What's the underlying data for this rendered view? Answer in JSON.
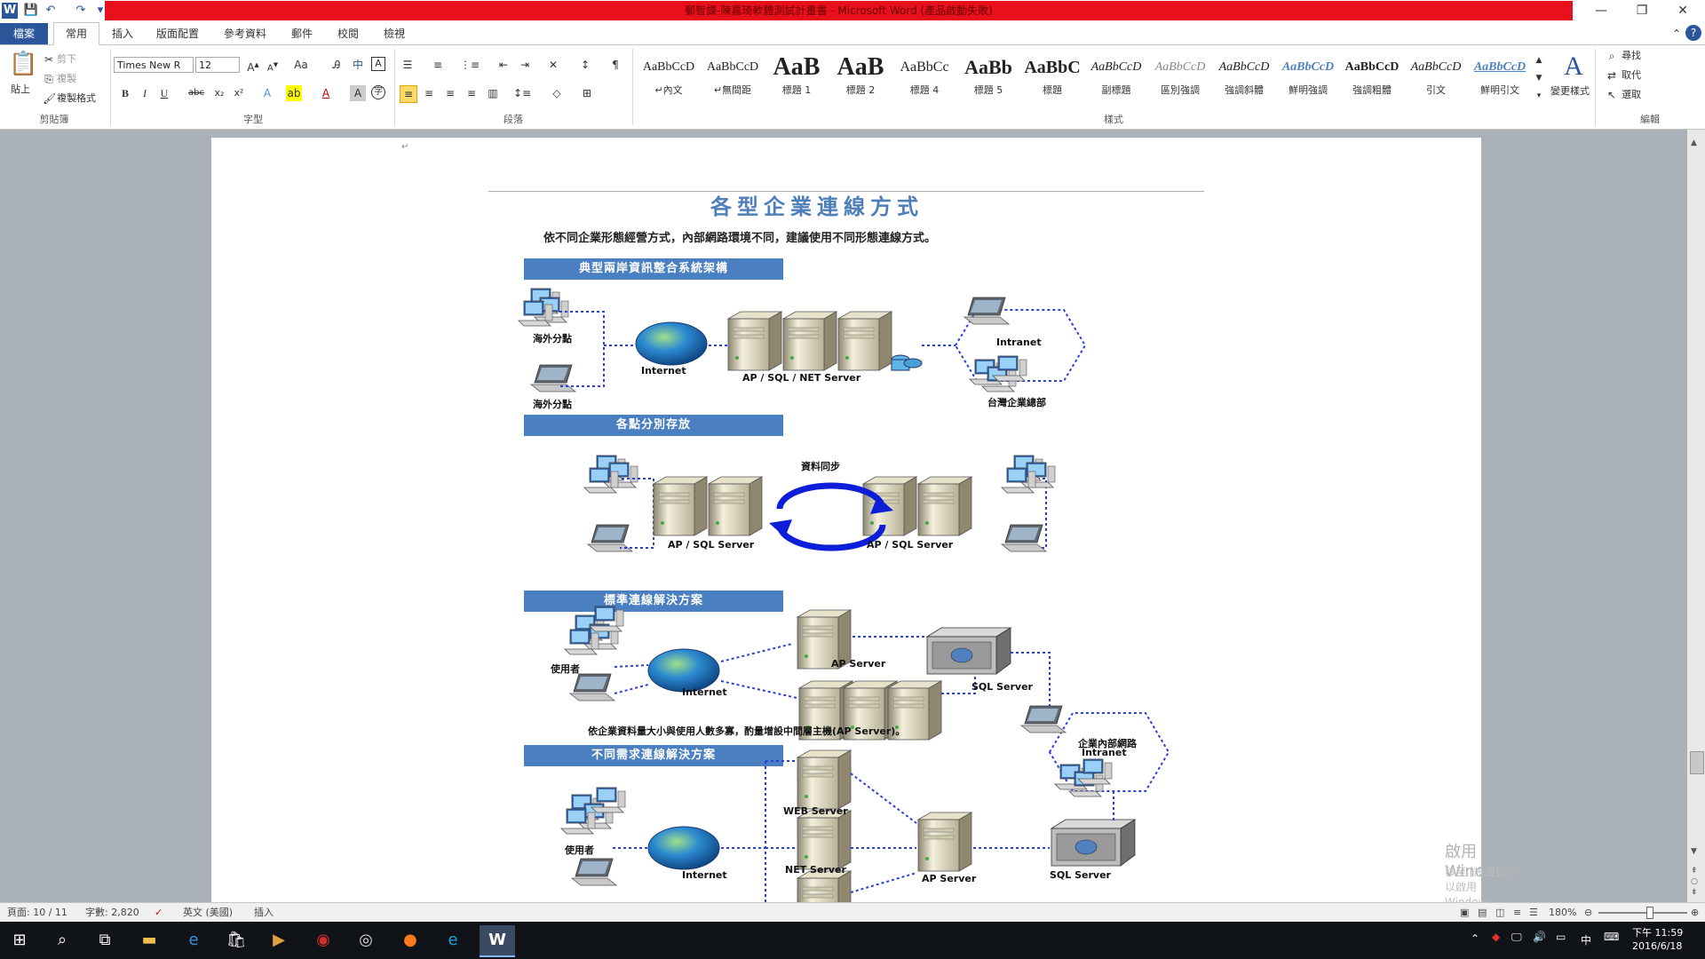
{
  "window": {
    "title": "郵智課-陳嘉琦軟體測試計畫書 - Microsoft Word (產品啟動失敗)",
    "app_icon": "W",
    "title_bar_color": "#e8101a",
    "controls": {
      "minimize": "—",
      "restore": "❐",
      "close": "✕"
    }
  },
  "quick_access": {
    "save": "💾",
    "undo": "↶",
    "redo": "↷",
    "customize": "▾"
  },
  "ribbon_tabs": [
    {
      "label": "檔案"
    },
    {
      "label": "常用"
    },
    {
      "label": "插入"
    },
    {
      "label": "版面配置"
    },
    {
      "label": "參考資料"
    },
    {
      "label": "郵件"
    },
    {
      "label": "校閱"
    },
    {
      "label": "檢視"
    }
  ],
  "ribbon": {
    "clipboard": {
      "group": "剪貼簿",
      "paste": "貼上",
      "cut": "剪下",
      "copy": "複製",
      "format_painter": "複製格式"
    },
    "font": {
      "group": "字型",
      "font_name": "Times New R",
      "font_size": "12"
    },
    "paragraph": {
      "group": "段落"
    },
    "styles": {
      "group": "樣式",
      "items": [
        {
          "sample": "AaBbCcD",
          "name": "↵內文"
        },
        {
          "sample": "AaBbCcD",
          "name": "↵無間距"
        },
        {
          "sample": "AaB",
          "name": "標題 1"
        },
        {
          "sample": "AaB",
          "name": "標題 2"
        },
        {
          "sample": "AaBbCc",
          "name": "標題 4"
        },
        {
          "sample": "AaBb",
          "name": "標題 5"
        },
        {
          "sample": "AaBbC",
          "name": "標題"
        },
        {
          "sample": "AaBbCcD",
          "name": "副標題"
        },
        {
          "sample": "AaBbCcD",
          "name": "區別強調"
        },
        {
          "sample": "AaBbCcD",
          "name": "強調斜體"
        },
        {
          "sample": "AaBbCcD",
          "name": "鮮明強調"
        },
        {
          "sample": "AaBbCcD",
          "name": "強調粗體"
        },
        {
          "sample": "AaBbCcD",
          "name": "引文"
        },
        {
          "sample": "AaBbCcD",
          "name": "鮮明引文"
        }
      ],
      "change_styles": "變更樣式"
    },
    "editing": {
      "group": "編輯",
      "find": "尋找",
      "replace": "取代",
      "select": "選取"
    }
  },
  "document": {
    "title": "各型企業連線方式",
    "subtitle": "依不同企業形態經營方式，內部網路環境不同，建議使用不同形態連線方式。",
    "sections": [
      {
        "heading": "典型兩岸資訊整合系統架構"
      },
      {
        "heading": "各點分別存放"
      },
      {
        "heading": "標準連線解決方案"
      },
      {
        "heading": "不同需求連線解決方案"
      }
    ],
    "diagram1": {
      "branch_top": "海外分點",
      "branch_bottom": "海外分點",
      "internet": "Internet",
      "server": "AP / SQL / NET Server",
      "intranet": "Intranet",
      "hq": "台灣企業總部"
    },
    "diagram2": {
      "sync_label": "資料同步",
      "left_server": "AP / SQL Server",
      "right_server": "AP / SQL Server"
    },
    "diagram3": {
      "users": "使用者",
      "internet": "Internet",
      "ap_server": "AP Server",
      "sql_server": "SQL Server",
      "caption": "依企業資料量大小與使用人數多寡，酌量增設中間層主機(AP Server)。",
      "intranet_label": "企業內部網路",
      "intranet": "Intranet"
    },
    "diagram4": {
      "users": "使用者",
      "internet": "Internet",
      "web_server": "WEB Server",
      "net_server": "NET Server",
      "ap_server": "AP Server",
      "sql_server": "SQL Server"
    },
    "watermark": {
      "line1": "啟用 Windows",
      "line2": "移至 [設定] 以啟用 Windows。"
    }
  },
  "statusbar": {
    "page": "頁面: 10 / 11",
    "words": "字數: 2,820",
    "language": "英文 (美國)",
    "mode": "插入",
    "zoom": "180%"
  },
  "taskbar": {
    "clock_time": "下午 11:59",
    "clock_date": "2016/6/18",
    "ime": "中"
  }
}
